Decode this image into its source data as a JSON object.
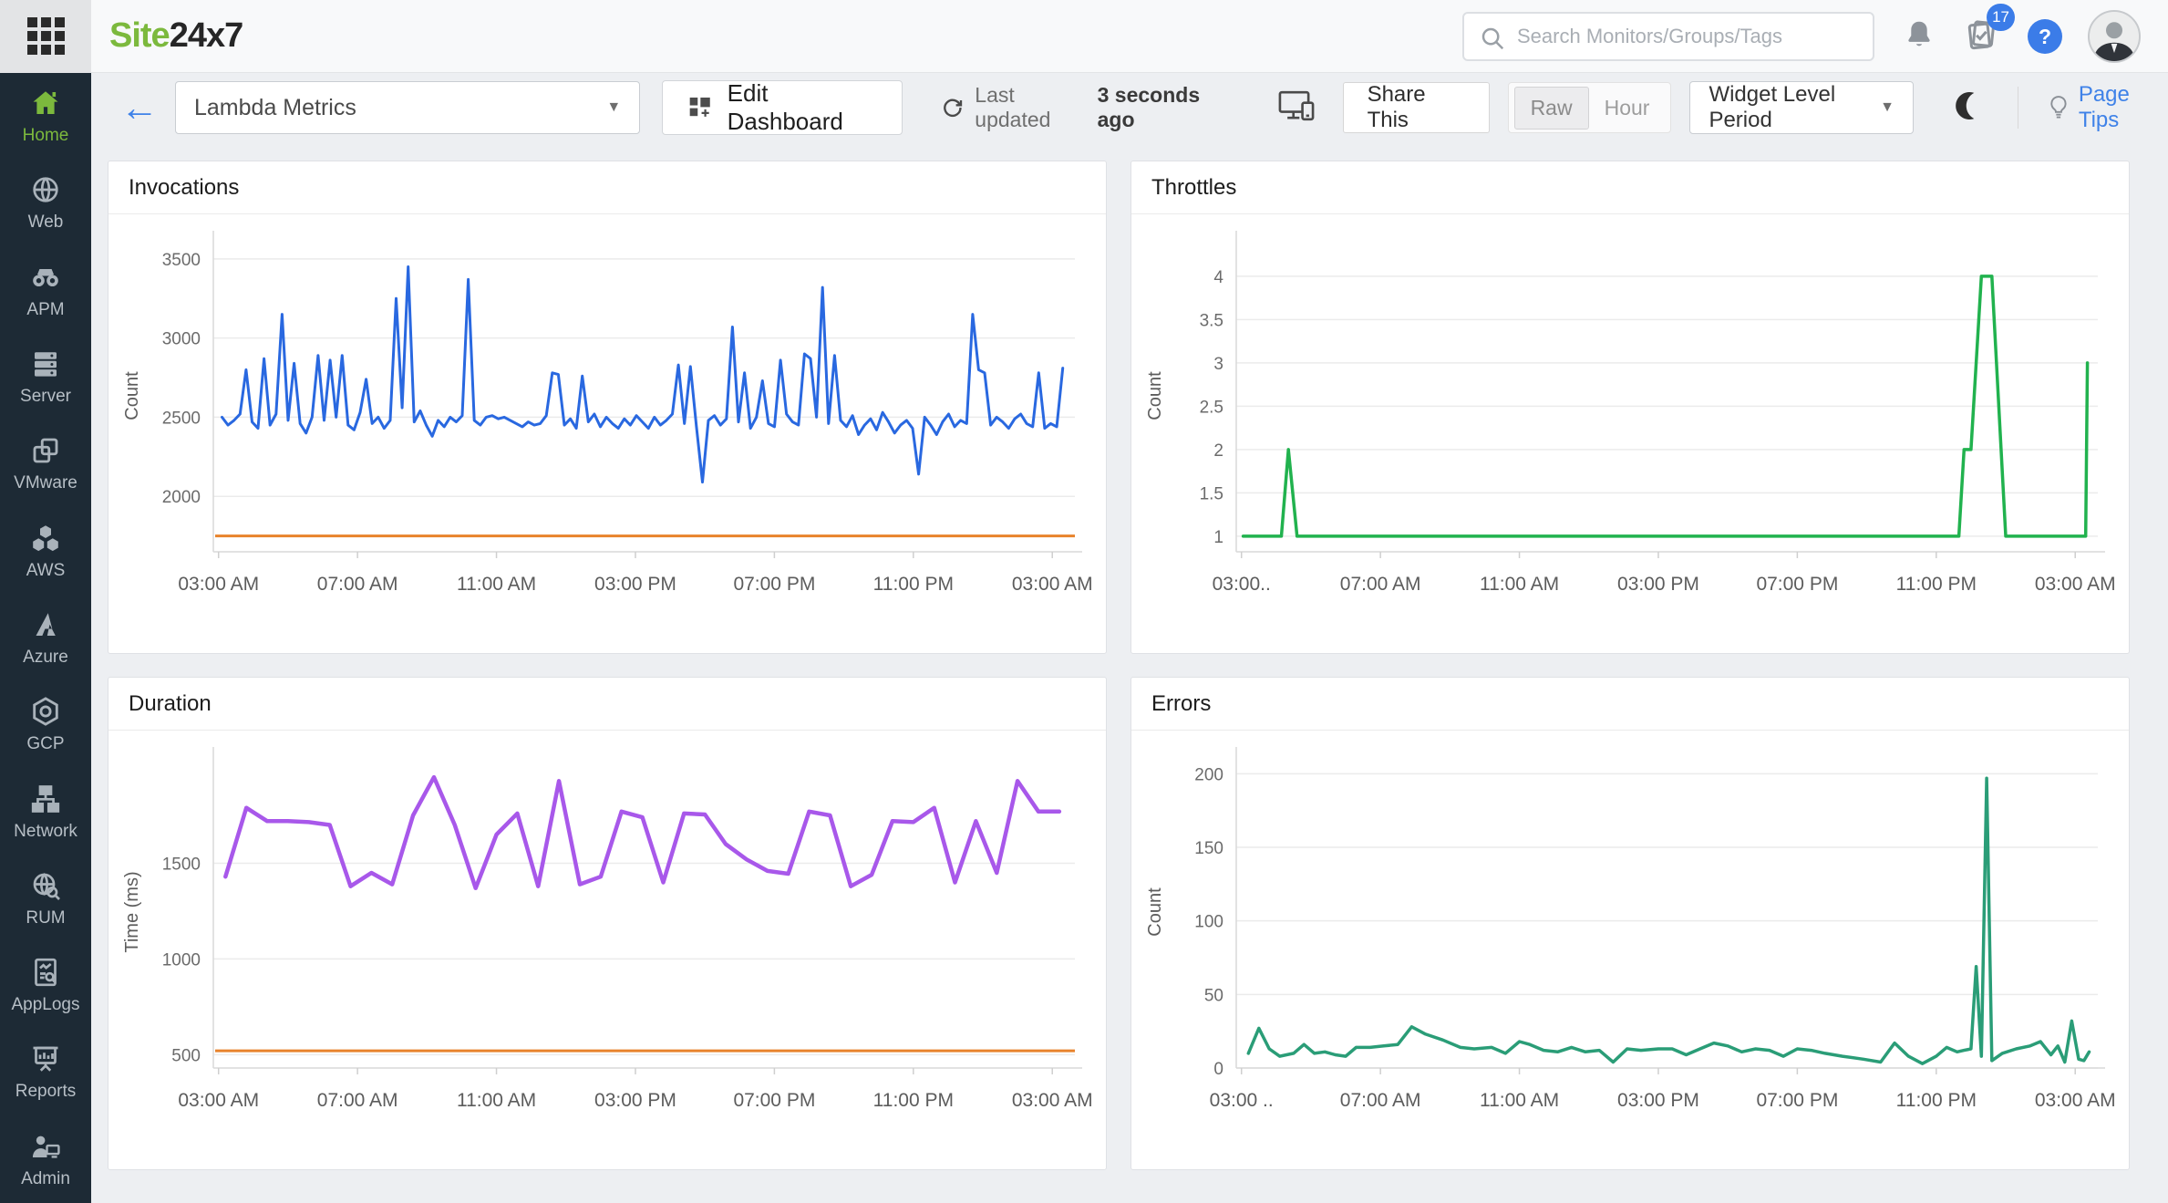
{
  "header": {
    "logo_site": "Site",
    "logo_24x7": "24x7",
    "search_placeholder": "Search Monitors/Groups/Tags",
    "notifications_badge": "17",
    "help_glyph": "?"
  },
  "toolbar": {
    "dashboard_name": "Lambda Metrics",
    "edit_dashboard": "Edit Dashboard",
    "last_updated_label": "Last updated",
    "last_updated_value": "3 seconds ago",
    "share_this": "Share This",
    "raw_label": "Raw",
    "hour_label": "Hour",
    "granularity_selected": "Raw",
    "period_selector": "Widget Level Period",
    "page_tips": "Page Tips"
  },
  "sidebar": {
    "items": [
      {
        "label": "Home",
        "active": true
      },
      {
        "label": "Web",
        "active": false
      },
      {
        "label": "APM",
        "active": false
      },
      {
        "label": "Server",
        "active": false
      },
      {
        "label": "VMware",
        "active": false
      },
      {
        "label": "AWS",
        "active": false
      },
      {
        "label": "Azure",
        "active": false
      },
      {
        "label": "GCP",
        "active": false
      },
      {
        "label": "Network",
        "active": false
      },
      {
        "label": "RUM",
        "active": false
      },
      {
        "label": "AppLogs",
        "active": false
      },
      {
        "label": "Reports",
        "active": false
      },
      {
        "label": "Admin",
        "active": false
      }
    ]
  },
  "colors": {
    "threshold_line": "#e8832c",
    "accent_blue": "#3b7ce8",
    "sidebar_active_green": "#7cb93d",
    "invocations_line": "#2968e0",
    "throttles_line": "#21b24e",
    "duration_line": "#a858ea",
    "errors_line": "#2a9d77"
  },
  "chart_data": [
    {
      "type": "line",
      "title": "Invocations",
      "ylabel": "Count",
      "color": "#2968e0",
      "stroke_width": 3,
      "threshold": 1750,
      "ylim": [
        1650,
        3620
      ],
      "yticks": [
        2000,
        2500,
        3000,
        3500
      ],
      "xlim": [
        2.85,
        27.65
      ],
      "xticks": [
        {
          "h": 3,
          "label": "03:00 AM"
        },
        {
          "h": 7,
          "label": "07:00 AM"
        },
        {
          "h": 11,
          "label": "11:00 AM"
        },
        {
          "h": 15,
          "label": "03:00 PM"
        },
        {
          "h": 19,
          "label": "07:00 PM"
        },
        {
          "h": 23,
          "label": "11:00 PM"
        },
        {
          "h": 27,
          "label": "03:00 AM"
        }
      ],
      "x_unit": "hour-of-day",
      "xstart": 3.1,
      "xend": 27.3,
      "values": [
        2500,
        2450,
        2480,
        2520,
        2800,
        2470,
        2430,
        2870,
        2450,
        2520,
        3150,
        2480,
        2840,
        2460,
        2400,
        2500,
        2890,
        2480,
        2860,
        2500,
        2890,
        2450,
        2420,
        2530,
        2740,
        2460,
        2500,
        2430,
        2480,
        3250,
        2560,
        3450,
        2470,
        2540,
        2450,
        2380,
        2480,
        2440,
        2500,
        2470,
        2510,
        3370,
        2480,
        2450,
        2500,
        2510,
        2490,
        2500,
        2480,
        2460,
        2440,
        2470,
        2450,
        2460,
        2510,
        2780,
        2770,
        2450,
        2490,
        2430,
        2760,
        2470,
        2520,
        2440,
        2500,
        2460,
        2430,
        2490,
        2450,
        2510,
        2470,
        2430,
        2500,
        2450,
        2480,
        2520,
        2830,
        2460,
        2820,
        2440,
        2090,
        2480,
        2510,
        2450,
        2490,
        3070,
        2470,
        2780,
        2430,
        2500,
        2730,
        2460,
        2440,
        2860,
        2520,
        2470,
        2450,
        2900,
        2870,
        2500,
        3320,
        2460,
        2890,
        2480,
        2440,
        2510,
        2390,
        2450,
        2490,
        2420,
        2530,
        2470,
        2400,
        2450,
        2480,
        2430,
        2140,
        2500,
        2450,
        2390,
        2470,
        2520,
        2440,
        2480,
        2460,
        3150,
        2800,
        2780,
        2450,
        2500,
        2470,
        2430,
        2490,
        2520,
        2460,
        2440,
        2780,
        2430,
        2460,
        2440,
        2810
      ]
    },
    {
      "type": "line",
      "title": "Throttles",
      "ylabel": "Count",
      "color": "#21b24e",
      "stroke_width": 3.5,
      "threshold": null,
      "ylim": [
        0.82,
        4.42
      ],
      "yticks": [
        1,
        1.5,
        2,
        2.5,
        3,
        3.5,
        4
      ],
      "xlim": [
        2.85,
        27.65
      ],
      "xticks": [
        {
          "h": 3,
          "label": "03:00.."
        },
        {
          "h": 7,
          "label": "07:00 AM"
        },
        {
          "h": 11,
          "label": "11:00 AM"
        },
        {
          "h": 15,
          "label": "03:00 PM"
        },
        {
          "h": 19,
          "label": "07:00 PM"
        },
        {
          "h": 23,
          "label": "11:00 PM"
        },
        {
          "h": 27,
          "label": "03:00 AM"
        }
      ],
      "x_unit": "hour-of-day",
      "points": [
        [
          3.05,
          1
        ],
        [
          3.3,
          1
        ],
        [
          4.15,
          1
        ],
        [
          4.35,
          2
        ],
        [
          4.6,
          1
        ],
        [
          23.65,
          1
        ],
        [
          23.8,
          2
        ],
        [
          24.0,
          2
        ],
        [
          24.3,
          4
        ],
        [
          24.6,
          4
        ],
        [
          25.0,
          1
        ],
        [
          27.3,
          1
        ],
        [
          27.35,
          3
        ]
      ]
    },
    {
      "type": "line",
      "title": "Duration",
      "ylabel": "Time (ms)",
      "color": "#a858ea",
      "stroke_width": 4.5,
      "threshold": 520,
      "ylim": [
        430,
        2060
      ],
      "yticks": [
        500,
        1000,
        1500
      ],
      "xlim": [
        2.85,
        27.65
      ],
      "xticks": [
        {
          "h": 3,
          "label": "03:00 AM"
        },
        {
          "h": 7,
          "label": "07:00 AM"
        },
        {
          "h": 11,
          "label": "11:00 AM"
        },
        {
          "h": 15,
          "label": "03:00 PM"
        },
        {
          "h": 19,
          "label": "07:00 PM"
        },
        {
          "h": 23,
          "label": "11:00 PM"
        },
        {
          "h": 27,
          "label": "03:00 AM"
        }
      ],
      "x_unit": "hour-of-day",
      "xstart": 3.2,
      "xend": 27.2,
      "values": [
        1430,
        1790,
        1720,
        1720,
        1715,
        1700,
        1380,
        1450,
        1390,
        1750,
        1950,
        1700,
        1370,
        1650,
        1760,
        1380,
        1930,
        1390,
        1430,
        1770,
        1740,
        1400,
        1760,
        1755,
        1600,
        1520,
        1460,
        1445,
        1770,
        1750,
        1380,
        1440,
        1720,
        1715,
        1790,
        1400,
        1720,
        1450,
        1930,
        1770,
        1770
      ]
    },
    {
      "type": "line",
      "title": "Errors",
      "ylabel": "Count",
      "color": "#2a9d77",
      "stroke_width": 3.5,
      "threshold": null,
      "ylim": [
        0,
        212
      ],
      "yticks": [
        0,
        50,
        100,
        150,
        200
      ],
      "xlim": [
        2.85,
        27.65
      ],
      "xticks": [
        {
          "h": 3,
          "label": "03:00 .."
        },
        {
          "h": 7,
          "label": "07:00 AM"
        },
        {
          "h": 11,
          "label": "11:00 AM"
        },
        {
          "h": 15,
          "label": "03:00 PM"
        },
        {
          "h": 19,
          "label": "07:00 PM"
        },
        {
          "h": 23,
          "label": "11:00 PM"
        },
        {
          "h": 27,
          "label": "03:00 AM"
        }
      ],
      "x_unit": "hour-of-day",
      "points": [
        [
          3.2,
          10
        ],
        [
          3.5,
          27
        ],
        [
          3.8,
          13
        ],
        [
          4.1,
          8
        ],
        [
          4.5,
          10
        ],
        [
          4.8,
          16
        ],
        [
          5.1,
          10
        ],
        [
          5.4,
          11
        ],
        [
          5.7,
          9
        ],
        [
          6.0,
          8
        ],
        [
          6.3,
          14
        ],
        [
          6.7,
          14
        ],
        [
          7.1,
          15
        ],
        [
          7.5,
          16
        ],
        [
          7.9,
          28
        ],
        [
          8.3,
          23
        ],
        [
          8.8,
          19
        ],
        [
          9.3,
          14
        ],
        [
          9.7,
          13
        ],
        [
          10.2,
          14
        ],
        [
          10.6,
          10
        ],
        [
          11.0,
          18
        ],
        [
          11.3,
          16
        ],
        [
          11.7,
          12
        ],
        [
          12.1,
          11
        ],
        [
          12.5,
          14
        ],
        [
          12.9,
          11
        ],
        [
          13.3,
          12
        ],
        [
          13.7,
          4
        ],
        [
          14.1,
          13
        ],
        [
          14.5,
          12
        ],
        [
          15.0,
          13
        ],
        [
          15.4,
          13
        ],
        [
          15.8,
          9
        ],
        [
          16.2,
          13
        ],
        [
          16.6,
          17
        ],
        [
          17.0,
          15
        ],
        [
          17.4,
          11
        ],
        [
          17.8,
          13
        ],
        [
          18.2,
          12
        ],
        [
          18.6,
          8
        ],
        [
          19.0,
          13
        ],
        [
          19.4,
          12
        ],
        [
          19.8,
          10
        ],
        [
          20.3,
          8
        ],
        [
          20.9,
          6
        ],
        [
          21.4,
          4
        ],
        [
          21.8,
          17
        ],
        [
          22.2,
          8
        ],
        [
          22.6,
          3
        ],
        [
          23.0,
          8
        ],
        [
          23.3,
          14
        ],
        [
          23.6,
          11
        ],
        [
          23.8,
          12
        ],
        [
          24.0,
          13
        ],
        [
          24.15,
          69
        ],
        [
          24.3,
          8
        ],
        [
          24.45,
          197
        ],
        [
          24.6,
          5
        ],
        [
          24.9,
          10
        ],
        [
          25.3,
          13
        ],
        [
          25.7,
          15
        ],
        [
          26.0,
          18
        ],
        [
          26.3,
          9
        ],
        [
          26.5,
          15
        ],
        [
          26.7,
          4
        ],
        [
          26.9,
          32
        ],
        [
          27.1,
          6
        ],
        [
          27.25,
          5
        ],
        [
          27.4,
          11
        ]
      ]
    }
  ]
}
